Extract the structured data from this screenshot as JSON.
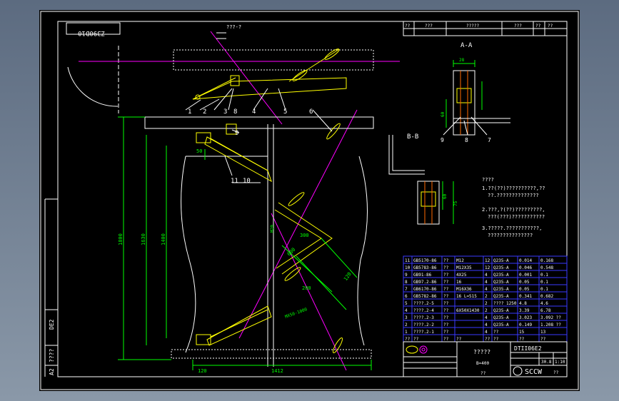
{
  "colors": {
    "border": "#ffffff",
    "part": "#ffff00",
    "dim": "#00ff00",
    "center": "#ff00ff",
    "table": "#3a3aff",
    "label": "#ffffff",
    "hatch": "#ff6a00"
  },
  "drawing": {
    "rev_box": "Z390D10",
    "side_label_top": "DE2",
    "side_label_mid": "????",
    "side_label_bot": "A2",
    "section_aa": "A-A",
    "section_bb": "B-B",
    "note_top": "???-?",
    "callouts": [
      "1",
      "2",
      "3",
      "8",
      "4",
      "5",
      "6",
      "9",
      "11",
      "10"
    ],
    "aa_callouts": [
      "9",
      "8",
      "7"
    ],
    "dims": {
      "h_total": "1800",
      "h_inner": "1630",
      "h_mid": "1400",
      "w_base": "1412",
      "w_left": "120",
      "w_left2": "50",
      "aa_w": "28",
      "aa_h": "60",
      "bb_h": "60",
      "bb_h2": "75",
      "angle_a": "300",
      "angle_b": "200",
      "seg": "120",
      "length": "600",
      "bolt": "M20",
      "longdim": "MX50-1000"
    }
  },
  "top_header": [
    "??",
    "???",
    "?????",
    "???",
    "??",
    "??"
  ],
  "notes": {
    "title": "????",
    "items": [
      "1.??(??)??????????,??",
      "??.??????????????",
      "2.???,?(??)?????????,",
      "???(???)???????????",
      "3.?????.???????????,",
      "???????????????"
    ]
  },
  "parts_table": [
    [
      "11",
      "GB5170-86",
      "??",
      "M12",
      "12",
      "Q235-A",
      "0.014",
      "0.168"
    ],
    [
      "10",
      "GB5783-86",
      "??",
      "M12X35",
      "12",
      "Q235-A",
      "0.046",
      "0.548"
    ],
    [
      "9",
      "GB91-86",
      "??",
      "4X25",
      "4",
      "Q235-A",
      "0.001",
      "0.1"
    ],
    [
      "8",
      "GB97.2-86",
      "??",
      "16",
      "4",
      "Q235-A",
      "0.05",
      "0.1"
    ],
    [
      "7",
      "GB6170-86",
      "??",
      "M16X36",
      "4",
      "Q235-A",
      "0.05",
      "0.1"
    ],
    [
      "6",
      "GB5782-86",
      "??",
      "16 L=515",
      "2",
      "Q235-A",
      "0.341",
      "0.682"
    ],
    [
      "5",
      "????.2-5",
      "??",
      "",
      "2",
      "???? 1250",
      "4.8",
      "4.6"
    ],
    [
      "4",
      "????.2-4",
      "??",
      "6X50X1430",
      "2",
      "Q235-A",
      "3.39",
      "6.78"
    ],
    [
      "3",
      "????.2-3",
      "??",
      "",
      "4",
      "Q235-A",
      "3.023",
      "3.092 ??"
    ],
    [
      "2",
      "????.2-2",
      "??",
      "",
      "4",
      "Q235-A",
      "0.149",
      "1.208 ??"
    ],
    [
      "1",
      "????.2-1",
      "??",
      "",
      "4",
      "??",
      "15",
      "13"
    ]
  ],
  "table_header": [
    "??",
    "??",
    "??",
    "??",
    "??",
    "??",
    "??",
    "??"
  ],
  "title_block": {
    "drawing_name": "?????",
    "code": "DTII06E2",
    "spec": "B=400",
    "scale": "1:10",
    "ratio": "30.8",
    "sheet": "??",
    "company": "SCCW",
    "company_suffix": "??",
    "cells": [
      "?",
      "?",
      "?",
      "?",
      "??",
      "??"
    ]
  }
}
